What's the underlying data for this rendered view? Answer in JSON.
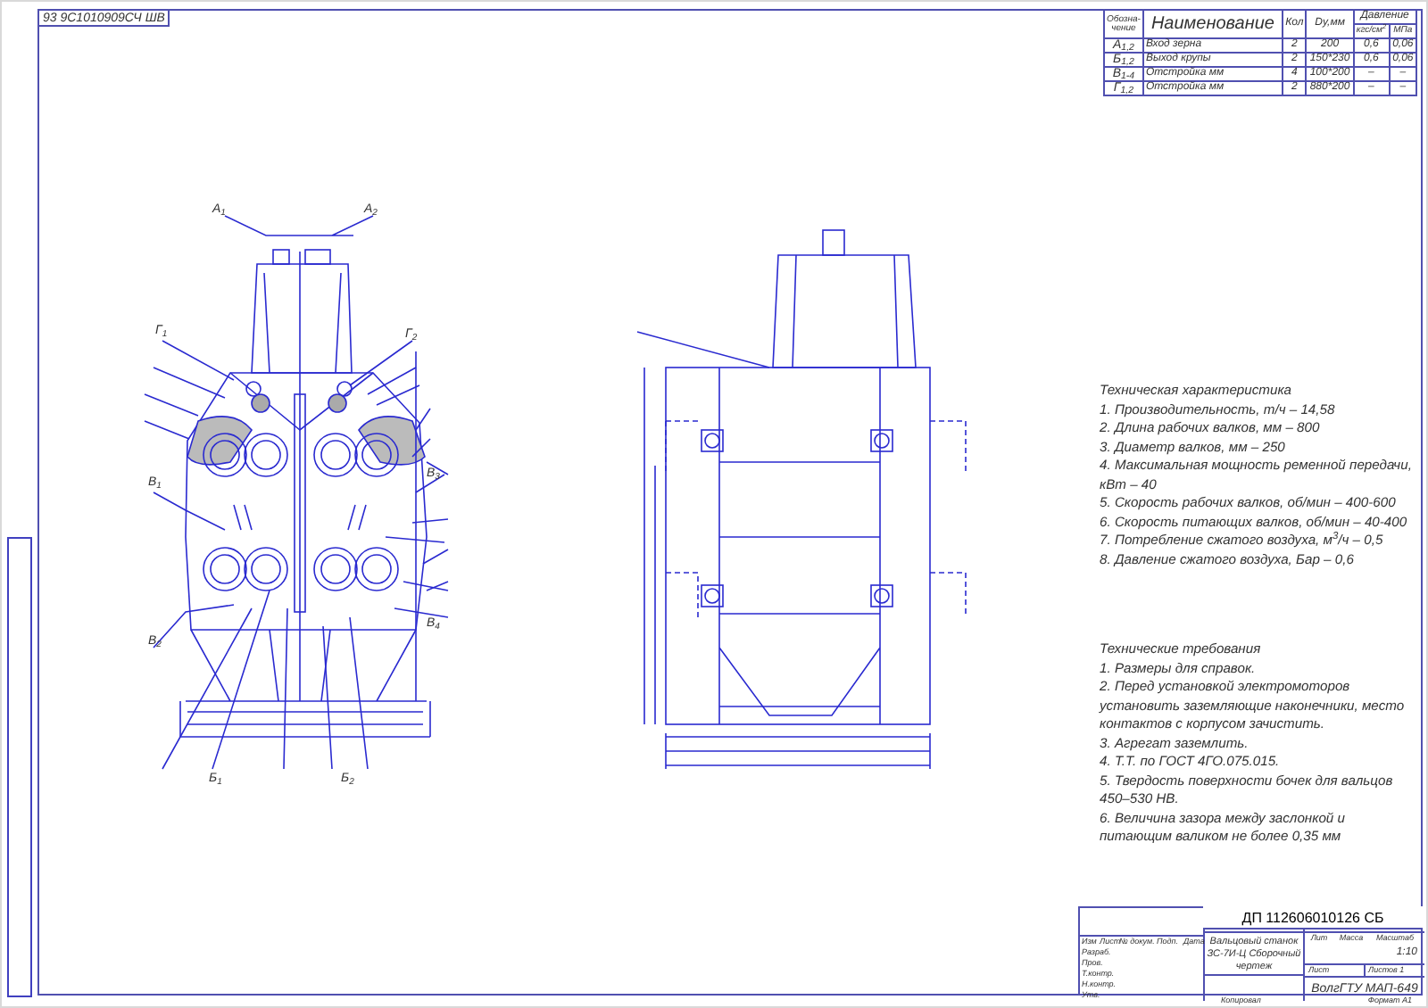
{
  "stamp": "93 9С1010909СЧ ШВ",
  "spec_table": {
    "columns": [
      "Обозна- чение",
      "Наименование",
      "Кол",
      "Dу,мм",
      "Давление"
    ],
    "pressure_units": [
      "кгс/см$^{2}$",
      "МПа"
    ],
    "rows": [
      {
        "designation": "А$_{1,2}$",
        "name": "Вход зерна",
        "qty": "2",
        "dn": "200",
        "p1": "0,6",
        "p2": "0,06"
      },
      {
        "designation": "Б$_{1,2}$",
        "name": "Выход крупы",
        "qty": "2",
        "dn": "150*230",
        "p1": "0,6",
        "p2": "0,06"
      },
      {
        "designation": "В$_{1-4}$",
        "name": "Отстройка мм",
        "qty": "4",
        "dn": "100*200",
        "p1": "–",
        "p2": "–"
      },
      {
        "designation": "Г$_{1,2}$",
        "name": "Отстройка мм",
        "qty": "2",
        "dn": "880*200",
        "p1": "–",
        "p2": "–"
      }
    ]
  },
  "front_view_labels": [
    "А$_{1}$",
    "А$_{2}$",
    "Г$_{1}$",
    "Г$_{2}$",
    "В$_{1}$",
    "В$_{2}$",
    "В$_{3}$",
    "В$_{4}$",
    "Б$_{1}$",
    "Б$_{2}$"
  ],
  "characteristics": {
    "title": "Техническая характеристика",
    "lines": [
      "1. Производительность, т/ч – 14,58",
      "2. Длина рабочих валков, мм – 800",
      "3. Диаметр валков, мм – 250",
      "4. Максимальная мощность ременной передачи, кВт – 40",
      "5. Скорость рабочих валков, об/мин – 400-600",
      "6. Скорость питающих валков, об/мин – 40-400",
      "7. Потребление сжатого воздуха, м$^{3}$/ч – 0,5",
      "8. Давление сжатого воздуха, Бар – 0,6"
    ]
  },
  "requirements": {
    "title": "Технические требования",
    "lines": [
      "1. Размеры для справок.",
      "2. Перед установкой электромоторов установить заземляющие наконечники, место контактов с корпусом зачистить.",
      "3. Агрегат заземлить.",
      "4. Т.Т. по ГОСТ 4ГО.075.015.",
      "5. Твердость поверхности бочек для вальцов 450–530 HB.",
      "6. Величина зазора между заслонкой и питающим валиком не более 0,35 мм"
    ]
  },
  "title_block": {
    "document_code": "ДП 112606010126 СБ",
    "product_name": "Вальцовый станок ЗС-7И-Ц Сборочный чертеж",
    "column_headers": [
      "Изм",
      "Лист",
      "№ докум.",
      "Подп.",
      "Дата"
    ],
    "roles": [
      "Разраб.",
      "Пров.",
      "Т.контр.",
      "Н.контр.",
      "Утв."
    ],
    "meta_headers": [
      "Лит",
      "Масса",
      "Масштаб"
    ],
    "scale": "1:10",
    "sheet": "Лист",
    "sheets": "Листов 1",
    "organization": "ВолгГТУ МАП-649",
    "copied": "Копировал",
    "format": "Формат А1"
  }
}
